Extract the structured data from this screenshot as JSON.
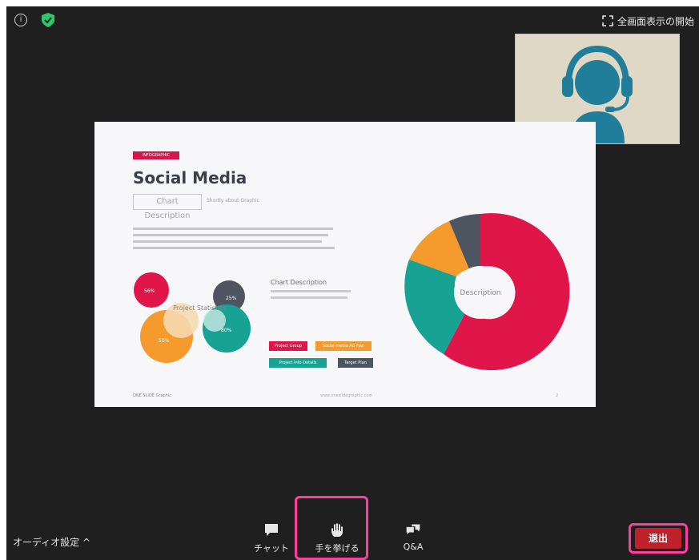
{
  "window": {
    "background": "#1f1f1f"
  },
  "topbar": {
    "info_icon": "info-icon",
    "shield_icon": "shield-check-icon",
    "fullscreen_label": "全画面表示の開始"
  },
  "video": {
    "participant_avatar": "headset-agent-avatar"
  },
  "slide": {
    "tag": "INFOGRAPHIC",
    "title": "Social Media",
    "subtitle": "Chart Description",
    "subtitle_note": "Shortly about Graphic",
    "chart_description": "Chart Description",
    "circle_label": "Project Statistics",
    "donut_center": "Description",
    "legend": [
      "Project Group",
      "Social media Ad Plan",
      "Project Info Details",
      "Target Plan"
    ],
    "footer_left": "ONE SLIDE Graphic",
    "footer_mid": "www.oneslidegraphic.com",
    "footer_page": "2",
    "circle_percent_labels": [
      "56%",
      "25%",
      "50%",
      "80%"
    ]
  },
  "bottombar": {
    "audio_settings": "オーディオ設定 ^",
    "chat_label": "チャット",
    "raise_hand_label": "手を挙げる",
    "qa_label": "Q&A",
    "leave_label": "退出"
  },
  "colors": {
    "accent_highlight": "#ff3f9f",
    "leave": "#c0202a",
    "donut_red": "#e0164a",
    "donut_teal": "#18a294",
    "donut_orange": "#f59a2c",
    "donut_gray": "#4d5560"
  }
}
